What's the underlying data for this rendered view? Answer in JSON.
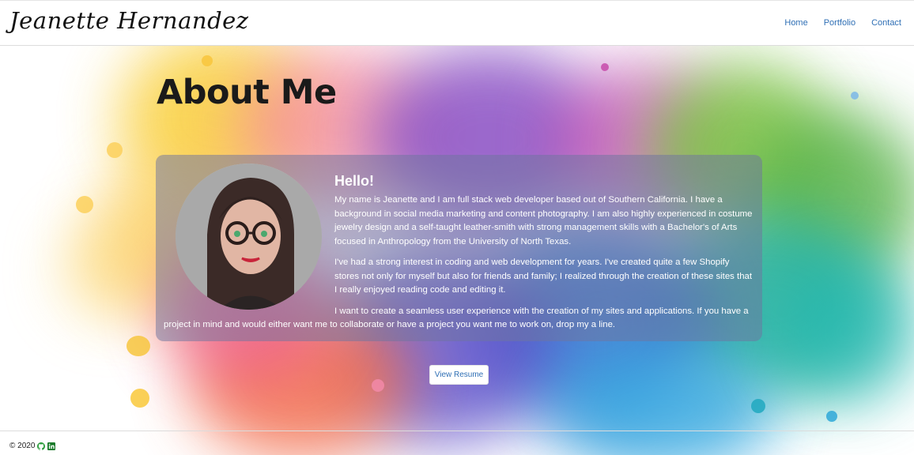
{
  "header": {
    "brand": "Jeanette Hernandez",
    "nav": [
      "Home",
      "Portfolio",
      "Contact"
    ]
  },
  "main": {
    "title": "About Me",
    "card": {
      "heading": "Hello!",
      "paragraphs": [
        "My name is Jeanette and I am full stack web developer based out of Southern California. I have a background in social media marketing and content photography. I am also highly experienced in costume jewelry design and a self-taught leather-smith with strong management skills with a Bachelor's of Arts focused in Anthropology from the University of North Texas.",
        "I've had a strong interest in coding and web development for years. I've created quite a few Shopify stores not only for myself but also for friends and family; I realized through the creation of these sites that I really enjoyed reading code and editing it.",
        "I want to create a seamless user experience with the creation of my sites and applications. If you have a project in mind and would either want me to collaborate or have a project you want me to work on, drop my a line."
      ]
    },
    "resume_button": "View Resume"
  },
  "footer": {
    "copyright": "© 2020",
    "icons": [
      "github-icon",
      "linkedin-icon"
    ]
  },
  "colors": {
    "link": "#2f6fb5",
    "card_overlay": "#7074a0",
    "github": "#2a9c3a",
    "linkedin": "#1a7a2a"
  }
}
